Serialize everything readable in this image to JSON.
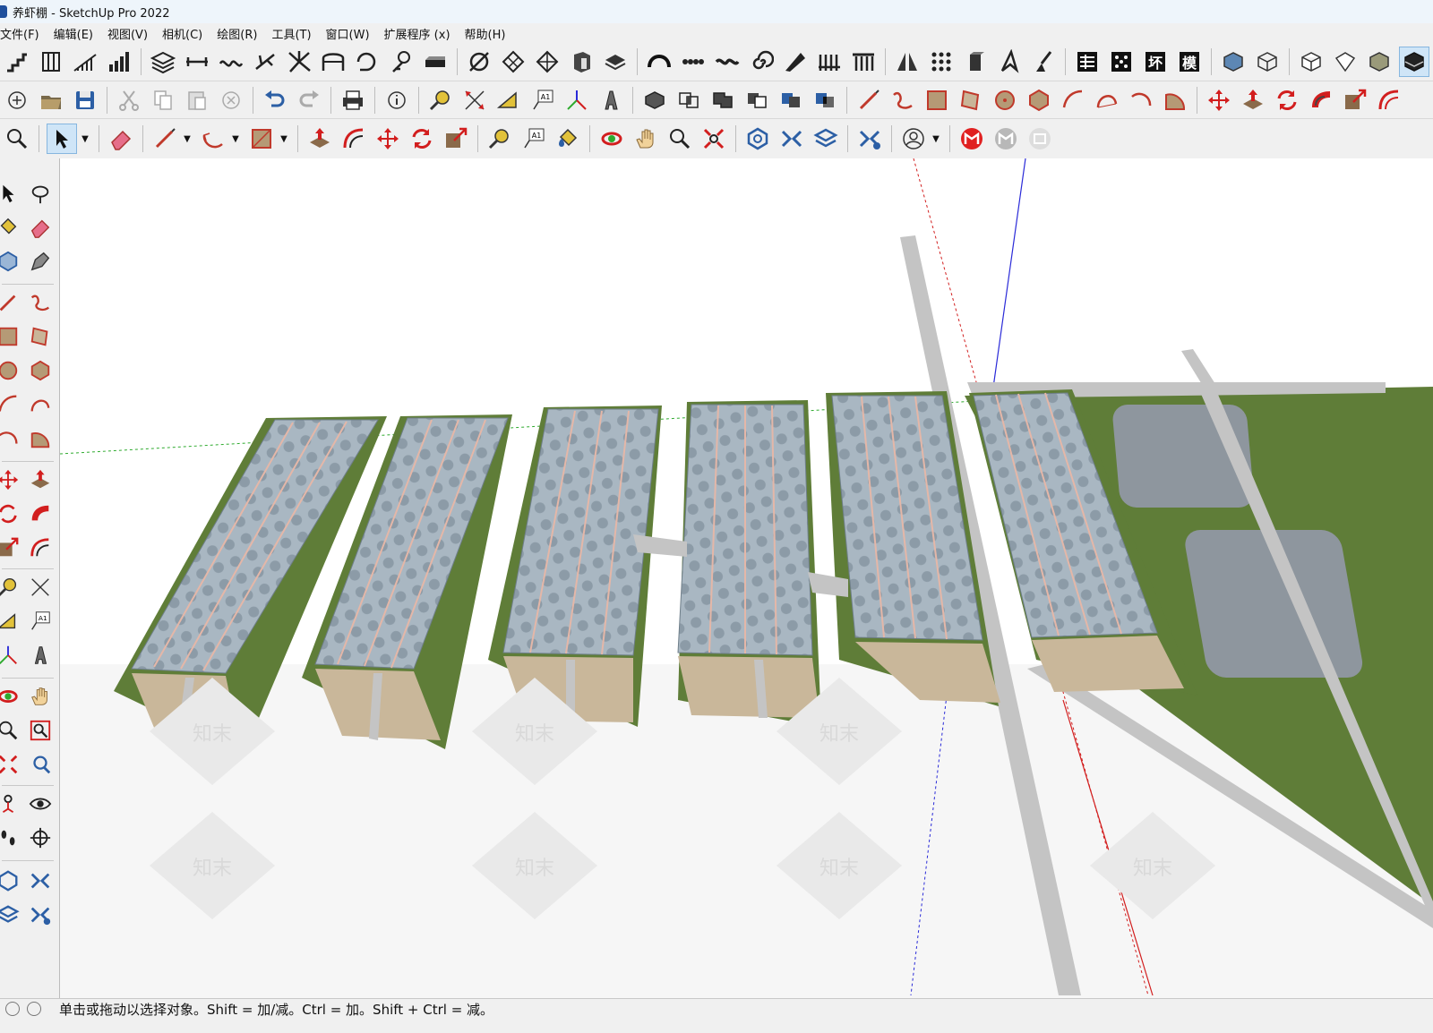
{
  "window": {
    "title": "养虾棚 - SketchUp Pro 2022"
  },
  "menu": {
    "items": [
      "文件(F)",
      "编辑(E)",
      "视图(V)",
      "相机(C)",
      "绘图(R)",
      "工具(T)",
      "窗口(W)",
      "扩展程序 (x)",
      "帮助(H)"
    ]
  },
  "toolbar_row3": {
    "dropdown_arrow": "▼",
    "text_tool_label": "A1"
  },
  "leftbar": {
    "text_tool_label": "A1"
  },
  "viewport": {
    "watermark_text": "知末"
  },
  "status": {
    "hint": "单击或拖动以选择对象。Shift = 加/减。Ctrl = 加。Shift + Ctrl = 减。"
  },
  "colors": {
    "accent": "#cfe5f7",
    "ground": "#5f7d38",
    "road": "#c4c4c4",
    "axis_red": "#d21e1e",
    "axis_green": "#2eaa2e",
    "axis_blue": "#2a2ad8",
    "pond": "#8e969e",
    "greenhouse": "#9fb0bd"
  }
}
